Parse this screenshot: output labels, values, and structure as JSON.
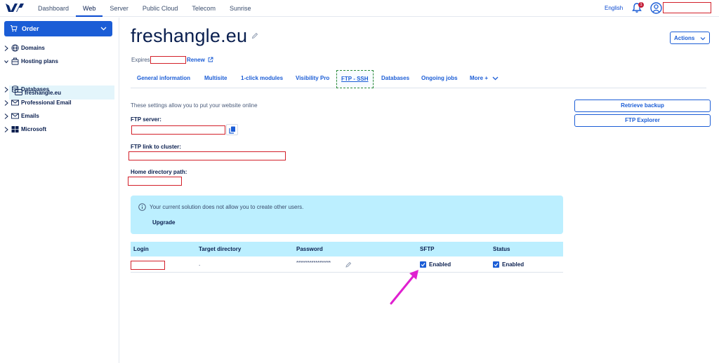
{
  "topnav": {
    "items": [
      "Dashboard",
      "Web",
      "Server",
      "Public Cloud",
      "Telecom",
      "Sunrise"
    ],
    "active": "Web",
    "language": "English",
    "notification_count": "1"
  },
  "sidebar": {
    "order_label": "Order",
    "items": [
      {
        "label": "Domains",
        "icon": "globe-icon"
      },
      {
        "label": "Hosting plans",
        "icon": "hosting-icon"
      },
      {
        "label": "Databases",
        "icon": "database-icon"
      },
      {
        "label": "Professional Email",
        "icon": "mail-icon"
      },
      {
        "label": "Emails",
        "icon": "mail-icon"
      },
      {
        "label": "Microsoft",
        "icon": "windows-icon"
      }
    ],
    "sub_item": "freshangle.eu"
  },
  "main": {
    "title": "freshangle.eu",
    "actions_label": "Actions",
    "expires_label": "Expires",
    "renew_label": "Renew",
    "tabs": [
      "General information",
      "Multisite",
      "1-click modules",
      "Visibility Pro",
      "FTP - SSH",
      "Databases",
      "Ongoing jobs",
      "More +"
    ],
    "active_tab": "FTP - SSH",
    "description": "These settings allow you to put your website online",
    "ftp_server_label": "FTP server:",
    "ftp_link_label": "FTP link to cluster:",
    "home_dir_label": "Home directory path:",
    "retrieve_backup_label": "Retrieve backup",
    "ftp_explorer_label": "FTP Explorer",
    "info_text": "Your current solution does not allow you to create other users.",
    "upgrade_label": "Upgrade",
    "table": {
      "headers": [
        "Login",
        "Target directory",
        "Password",
        "SFTP",
        "Status"
      ],
      "rows": [
        {
          "login": "",
          "target": ".",
          "password": "******************",
          "sftp": "Enabled",
          "status": "Enabled"
        }
      ]
    }
  },
  "colors": {
    "accent": "#1b5dd6",
    "info_bg": "#bcefff",
    "annotation": "#e020d0",
    "redaction": "#d3202a"
  }
}
